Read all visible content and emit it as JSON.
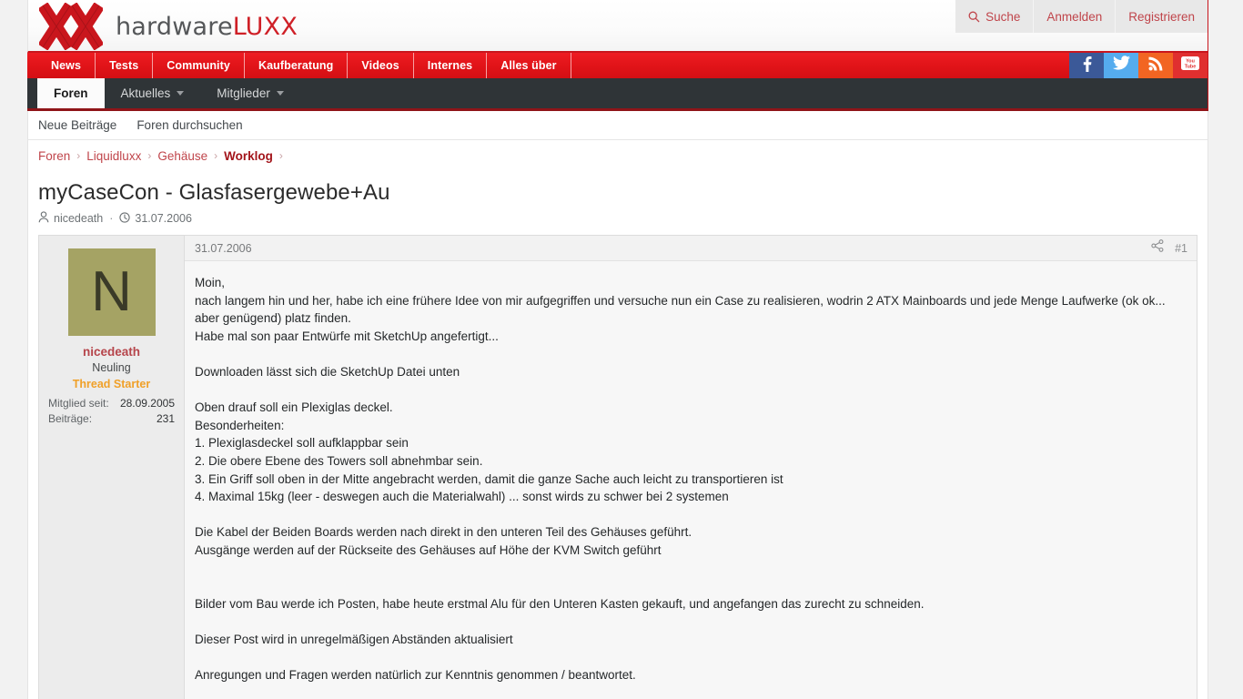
{
  "site": {
    "logo_text_primary": "hardware",
    "logo_text_accent": "LUXX",
    "brand_red": "#cf2027",
    "nav_red": "#e01318",
    "dark_bar": "#2f3437"
  },
  "header": {
    "links": [
      {
        "label": "Suche",
        "icon": "search-icon"
      },
      {
        "label": "Anmelden",
        "icon": null
      },
      {
        "label": "Registrieren",
        "icon": null
      }
    ]
  },
  "nav_main": {
    "items": [
      {
        "label": "News"
      },
      {
        "label": "Tests"
      },
      {
        "label": "Community"
      },
      {
        "label": "Kaufberatung"
      },
      {
        "label": "Videos"
      },
      {
        "label": "Internes"
      },
      {
        "label": "Alles über"
      }
    ]
  },
  "social": [
    {
      "name": "facebook-icon",
      "color": "#3b5998"
    },
    {
      "name": "twitter-icon",
      "color": "#55acee"
    },
    {
      "name": "rss-icon",
      "color": "#f26522"
    },
    {
      "name": "youtube-icon",
      "color": "#e02f2f"
    }
  ],
  "nav_sub": {
    "items": [
      {
        "label": "Foren",
        "active": true,
        "dropdown": false
      },
      {
        "label": "Aktuelles",
        "active": false,
        "dropdown": true
      },
      {
        "label": "Mitglieder",
        "active": false,
        "dropdown": true
      }
    ]
  },
  "nav_tertiary": {
    "items": [
      {
        "label": "Neue Beiträge"
      },
      {
        "label": "Foren durchsuchen"
      }
    ]
  },
  "breadcrumb": {
    "items": [
      {
        "label": "Foren",
        "current": false
      },
      {
        "label": "Liquidluxx",
        "current": false
      },
      {
        "label": "Gehäuse",
        "current": false
      },
      {
        "label": "Worklog",
        "current": true
      }
    ],
    "separator": "›"
  },
  "thread": {
    "title": "myCaseCon - Glasfasergewebe+Au",
    "author": "nicedeath",
    "date": "31.07.2006",
    "meta_separator": "·"
  },
  "post": {
    "author_sidebar": {
      "avatar_letter": "N",
      "avatar_color": "#a5a364",
      "username": "nicedeath",
      "rank": "Neuling",
      "badge": "Thread Starter",
      "stats": [
        {
          "label": "Mitglied seit:",
          "value": "28.09.2005"
        },
        {
          "label": "Beiträge:",
          "value": "231"
        }
      ]
    },
    "date": "31.07.2006",
    "number": "#1",
    "share_icon": "share-icon",
    "body": "Moin,\nnach langem hin und her, habe ich eine frühere Idee von mir aufgegriffen und versuche nun ein Case zu realisieren, wodrin 2 ATX Mainboards und jede Menge Laufwerke (ok ok... aber genügend) platz finden.\nHabe mal son paar Entwürfe mit SketchUp angefertigt...\n\nDownloaden lässt sich die SketchUp Datei unten\n\nOben drauf soll ein Plexiglas deckel.\nBesonderheiten:\n1. Plexiglasdeckel soll aufklappbar sein\n2. Die obere Ebene des Towers soll abnehmbar sein.\n3. Ein Griff soll oben in der Mitte angebracht werden, damit die ganze Sache auch leicht zu transportieren ist\n4. Maximal 15kg (leer - deswegen auch die Materialwahl) ... sonst wirds zu schwer bei 2 systemen\n\nDie Kabel der Beiden Boards werden nach direkt in den unteren Teil des Gehäuses geführt.\nAusgänge werden auf der Rückseite des Gehäuses auf Höhe der KVM Switch geführt\n\n\nBilder vom Bau werde ich Posten, habe heute erstmal Alu für den Unteren Kasten gekauft, und angefangen das zurecht zu schneiden.\n\nDieser Post wird in unregelmäßigen Abständen aktualisiert\n\nAnregungen und Fragen werden natürlich zur Kenntnis genommen / beantwortet."
  }
}
